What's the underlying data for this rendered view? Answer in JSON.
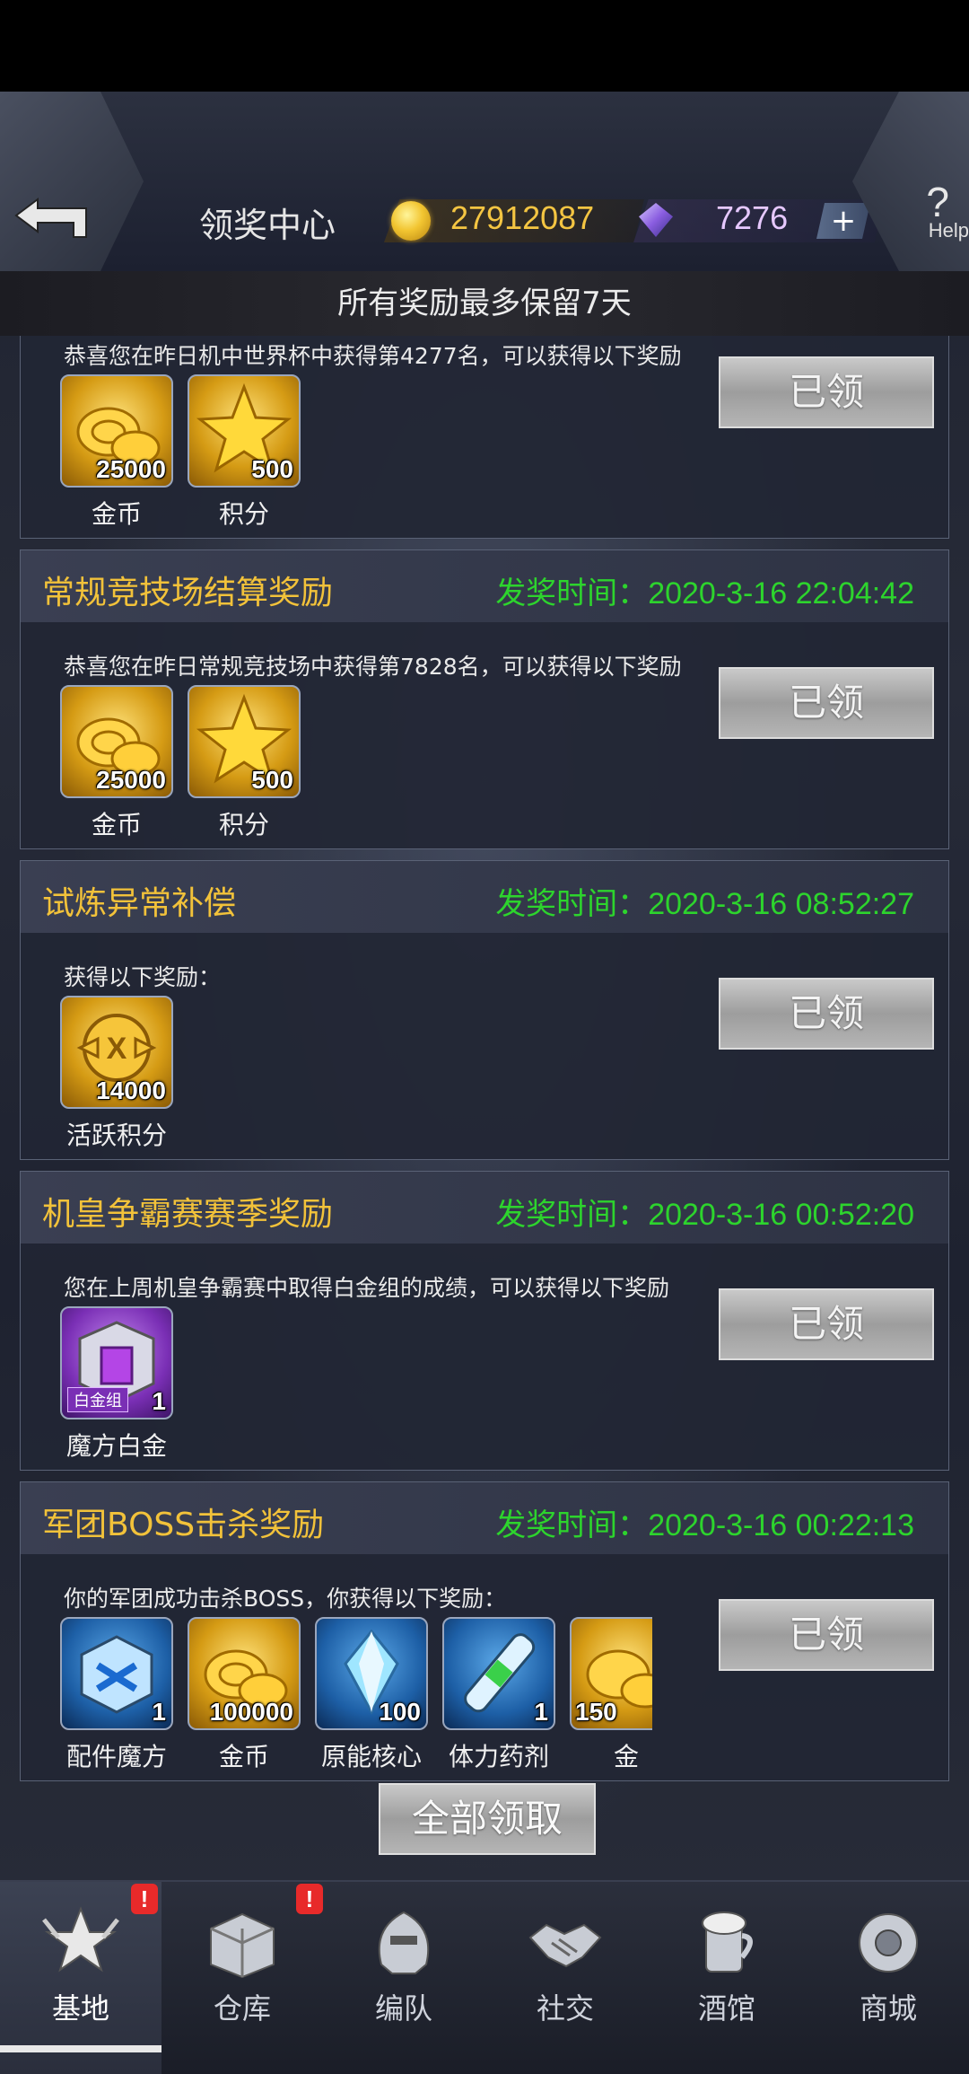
{
  "header": {
    "title": "领奖中心",
    "gold": "27912087",
    "gems": "7276",
    "plus": "+",
    "help_q": "?",
    "help_text": "Help"
  },
  "notice": "所有奖励最多保留7天",
  "time_label": "发奖时间：",
  "cards": [
    {
      "name": "",
      "time": "",
      "desc": "恭喜您在昨日机中世界杯中获得第4277名，可以获得以下奖励",
      "button": "已领",
      "items": [
        {
          "qty": "25000",
          "name": "金币",
          "icon": "gold-coin-icon"
        },
        {
          "qty": "500",
          "name": "积分",
          "icon": "star-points-icon"
        }
      ]
    },
    {
      "name": "常规竞技场结算奖励",
      "time": "2020-3-16 22:04:42",
      "desc": "恭喜您在昨日常规竞技场中获得第7828名，可以获得以下奖励",
      "button": "已领",
      "items": [
        {
          "qty": "25000",
          "name": "金币",
          "icon": "gold-coin-icon"
        },
        {
          "qty": "500",
          "name": "积分",
          "icon": "star-points-icon"
        }
      ]
    },
    {
      "name": "试炼异常补偿",
      "time": "2020-3-16 08:52:27",
      "desc": "获得以下奖励：",
      "button": "已领",
      "items": [
        {
          "qty": "14000",
          "name": "活跃积分",
          "icon": "activity-points-icon"
        }
      ]
    },
    {
      "name": "机皇争霸赛赛季奖励",
      "time": "2020-3-16 00:52:20",
      "desc": "您在上周机皇争霸赛中取得白金组的成绩，可以获得以下奖励",
      "button": "已领",
      "items": [
        {
          "qty": "1",
          "name": "魔方白金",
          "icon": "platinum-cube-icon",
          "tag": "白金组"
        }
      ]
    },
    {
      "name": "军团BOSS击杀奖励",
      "time": "2020-3-16 00:22:13",
      "desc": "你的军团成功击杀BOSS，你获得以下奖励：",
      "button": "已领",
      "items": [
        {
          "qty": "1",
          "name": "配件魔方",
          "icon": "parts-cube-icon"
        },
        {
          "qty": "100000",
          "name": "金币",
          "icon": "gold-coin-icon"
        },
        {
          "qty": "100",
          "name": "原能核心",
          "icon": "energy-core-icon"
        },
        {
          "qty": "1",
          "name": "体力药剂",
          "icon": "stamina-potion-icon"
        },
        {
          "qty": "150",
          "name": "金",
          "icon": "gold-coin-icon"
        }
      ]
    }
  ],
  "claim_all": "全部领取",
  "nav": [
    {
      "label": "基地",
      "icon": "base-icon",
      "badge": "!"
    },
    {
      "label": "仓库",
      "icon": "warehouse-icon",
      "badge": "!"
    },
    {
      "label": "编队",
      "icon": "squad-icon"
    },
    {
      "label": "社交",
      "icon": "handshake-icon"
    },
    {
      "label": "酒馆",
      "icon": "tavern-icon"
    },
    {
      "label": "商城",
      "icon": "shop-icon"
    }
  ]
}
